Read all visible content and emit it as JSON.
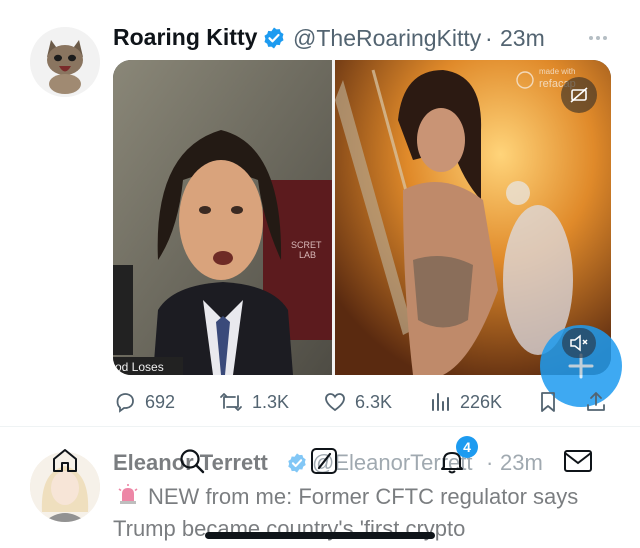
{
  "tweet1": {
    "display_name": "Roaring Kitty",
    "handle": "@TheRoaringKitty",
    "separator": "·",
    "time": "23m",
    "more_icon": "more-dots-icon",
    "media": {
      "left_overlay_text": "od Loses",
      "watermark_line1": "made with",
      "watermark_line2": "refacap"
    },
    "metrics": {
      "replies": "692",
      "reposts": "1.3K",
      "likes": "6.3K",
      "views": "226K"
    }
  },
  "tweet2": {
    "display_name": "Eleanor Terrett",
    "handle": "@EleanorTerrett",
    "separator": "·",
    "time": "23m",
    "text_line1": "NEW from me: Former CFTC regulator says",
    "text_line2": "Trump became country's 'first crypto"
  },
  "bottom_nav": {
    "notifications_badge": "4"
  },
  "colors": {
    "accent": "#1d9bf0",
    "text": "#0f1419",
    "muted": "#536471",
    "divider": "#eff3f4"
  }
}
